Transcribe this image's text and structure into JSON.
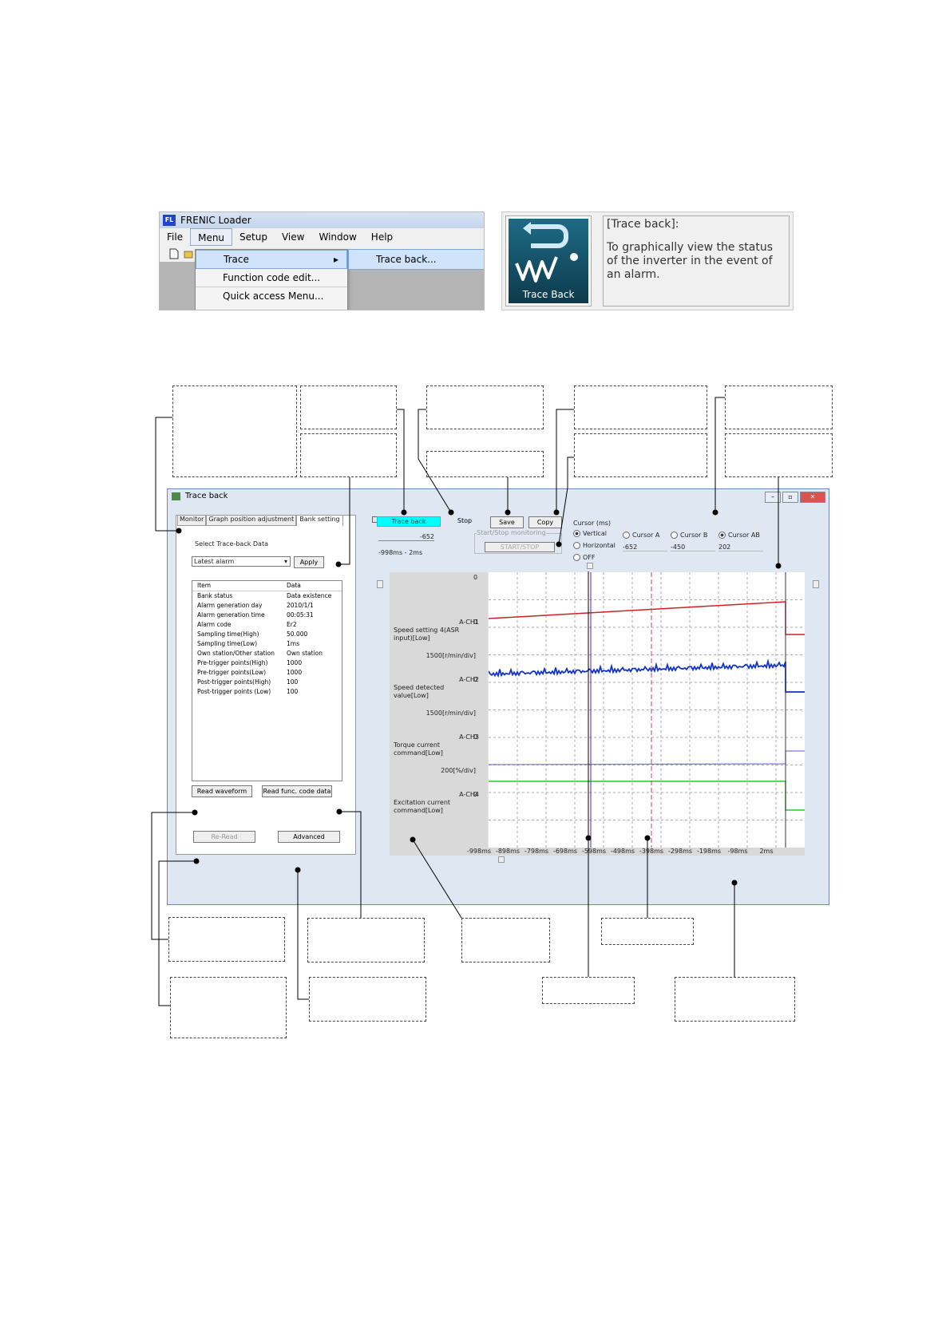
{
  "loader": {
    "title": "FRENIC Loader",
    "logo": "FL",
    "menubar": [
      "File",
      "Menu",
      "Setup",
      "View",
      "Window",
      "Help"
    ],
    "menu_items": [
      "Trace",
      "Function code edit...",
      "Quick access Menu..."
    ],
    "submenu_item": "Trace back..."
  },
  "tb_panel": {
    "icon_label": "Trace Back",
    "heading": "[Trace back]:",
    "description": "To graphically view the status of the inverter in the event of an alarm."
  },
  "window": {
    "title": "Trace back",
    "tabs": [
      "Monitor",
      "Graph position adjustment",
      "Bank setting"
    ],
    "select_label": "Select Trace-back Data",
    "dropdown_value": "Latest alarm",
    "apply_label": "Apply",
    "table_headers": [
      "Item",
      "Data"
    ],
    "table_rows": [
      [
        "Bank status",
        "Data existence"
      ],
      [
        "Alarm generation day",
        "2010/1/1"
      ],
      [
        "Alarm generation time",
        "00:05:31"
      ],
      [
        "Alarm code",
        "Er2"
      ],
      [
        "Sampling time(High)",
        "50.000"
      ],
      [
        "Sampling time(Low)",
        "1ms"
      ],
      [
        "Own station/Other station",
        "Own station"
      ],
      [
        "Pre-trigger points(High)",
        "1000"
      ],
      [
        "Pre-trigger points(Low)",
        "1000"
      ],
      [
        "Post-trigger points(High)",
        "100"
      ],
      [
        "Post-trigger points (Low)",
        "100"
      ]
    ],
    "read_waveform": "Read waveform",
    "read_func": "Read func. code data",
    "reread": "Re-Read",
    "advanced": "Advanced",
    "trace_back_btn": "Trace back",
    "stop_label": "Stop",
    "save_label": "Save",
    "copy_label": "Copy",
    "field_value": "-652",
    "range_label": "-998ms - 2ms",
    "start_stop_group": "Start/Stop monitoring",
    "start_stop_btn": "START/STOP",
    "cursor_group": "Cursor (ms)",
    "cursor_modes": [
      "Vertical",
      "Horizontal",
      "OFF"
    ],
    "cursor_labels": [
      "Cursor A",
      "Cursor B",
      "Cursor AB"
    ],
    "cursor_values": [
      "-652",
      "-450",
      "202"
    ]
  },
  "chart_data": {
    "type": "line",
    "x_ticks": [
      "-998ms",
      "-898ms",
      "-798ms",
      "-698ms",
      "-598ms",
      "-498ms",
      "-398ms",
      "-298ms",
      "-198ms",
      "-98ms",
      "2ms"
    ],
    "channels": [
      {
        "ch": "A-CH1",
        "zero": "0",
        "name": "Speed setting 4(ASR input)[Low]",
        "scale": "1500[r/min/div]",
        "color": "#cc2222"
      },
      {
        "ch": "A-CH2",
        "zero": "0",
        "name": "Speed detected value[Low]",
        "scale": "1500[r/min/div]",
        "color": "#1133cc"
      },
      {
        "ch": "A-CH3",
        "zero": "0",
        "name": "Torque current command[Low]",
        "scale": "200[%/div]",
        "color": "#7777dd"
      },
      {
        "ch": "A-CH4",
        "zero": "0",
        "name": "Excitation current command[Low]",
        "scale": "",
        "color": "#22cc22"
      }
    ],
    "top_zero": "0"
  }
}
